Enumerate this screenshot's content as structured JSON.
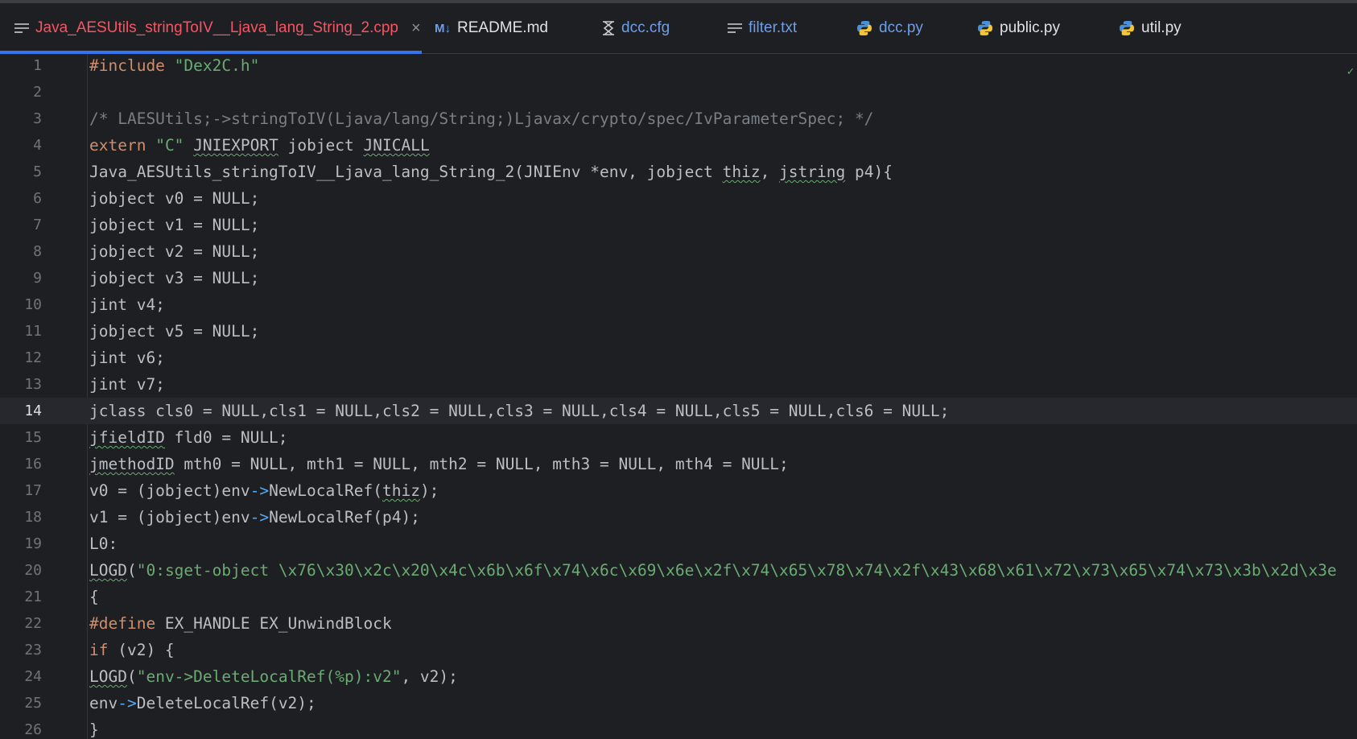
{
  "tabs": [
    {
      "label": "Java_AESUtils_stringToIV__Ljava_lang_String_2.cpp",
      "icon": "text-file-icon",
      "active": true,
      "close": "×"
    },
    {
      "label": "README.md",
      "icon": "markdown-icon",
      "active": false
    },
    {
      "label": "dcc.cfg",
      "icon": "config-file-icon",
      "active": false
    },
    {
      "label": "filter.txt",
      "icon": "text-file-icon",
      "active": false
    },
    {
      "label": "dcc.py",
      "icon": "python-icon",
      "active": false
    },
    {
      "label": "public.py",
      "icon": "python-icon",
      "active": false
    },
    {
      "label": "util.py",
      "icon": "python-icon",
      "active": false
    }
  ],
  "editor": {
    "current_line": 14,
    "lines": [
      {
        "n": "1",
        "text": "#include \"Dex2C.h\""
      },
      {
        "n": "2",
        "text": ""
      },
      {
        "n": "3",
        "text": "/* LAESUtils;->stringToIV(Ljava/lang/String;)Ljavax/crypto/spec/IvParameterSpec; */"
      },
      {
        "n": "4",
        "text": "extern \"C\" JNIEXPORT jobject JNICALL"
      },
      {
        "n": "5",
        "text": "Java_AESUtils_stringToIV__Ljava_lang_String_2(JNIEnv *env, jobject thiz, jstring p4){"
      },
      {
        "n": "6",
        "text": "jobject v0 = NULL;"
      },
      {
        "n": "7",
        "text": "jobject v1 = NULL;"
      },
      {
        "n": "8",
        "text": "jobject v2 = NULL;"
      },
      {
        "n": "9",
        "text": "jobject v3 = NULL;"
      },
      {
        "n": "10",
        "text": "jint v4;"
      },
      {
        "n": "11",
        "text": "jobject v5 = NULL;"
      },
      {
        "n": "12",
        "text": "jint v6;"
      },
      {
        "n": "13",
        "text": "jint v7;"
      },
      {
        "n": "14",
        "text": "jclass cls0 = NULL,cls1 = NULL,cls2 = NULL,cls3 = NULL,cls4 = NULL,cls5 = NULL,cls6 = NULL;"
      },
      {
        "n": "15",
        "text": "jfieldID fld0 = NULL;"
      },
      {
        "n": "16",
        "text": "jmethodID mth0 = NULL, mth1 = NULL, mth2 = NULL, mth3 = NULL, mth4 = NULL;"
      },
      {
        "n": "17",
        "text": "v0 = (jobject)env->NewLocalRef(thiz);"
      },
      {
        "n": "18",
        "text": "v1 = (jobject)env->NewLocalRef(p4);"
      },
      {
        "n": "19",
        "text": "L0:"
      },
      {
        "n": "20",
        "text": "LOGD(\"0:sget-object \\x76\\x30\\x2c\\x20\\x4c\\x6b\\x6f\\x74\\x6c\\x69\\x6e\\x2f\\x74\\x65\\x78\\x74\\x2f\\x43\\x68\\x61\\x72\\x73\\x65\\x74\\x73\\x3b\\x2d\\x3e"
      },
      {
        "n": "21",
        "text": "{"
      },
      {
        "n": "22",
        "text": "#define EX_HANDLE EX_UnwindBlock"
      },
      {
        "n": "23",
        "text": "if (v2) {"
      },
      {
        "n": "24",
        "text": "LOGD(\"env->DeleteLocalRef(%p):v2\", v2);"
      },
      {
        "n": "25",
        "text": "env->DeleteLocalRef(v2);"
      },
      {
        "n": "26",
        "text": "}"
      }
    ]
  },
  "colors": {
    "accent": "#3574f0",
    "active_tab_text": "#f75464",
    "keyword": "#cf8e6d",
    "string": "#6aab73"
  }
}
